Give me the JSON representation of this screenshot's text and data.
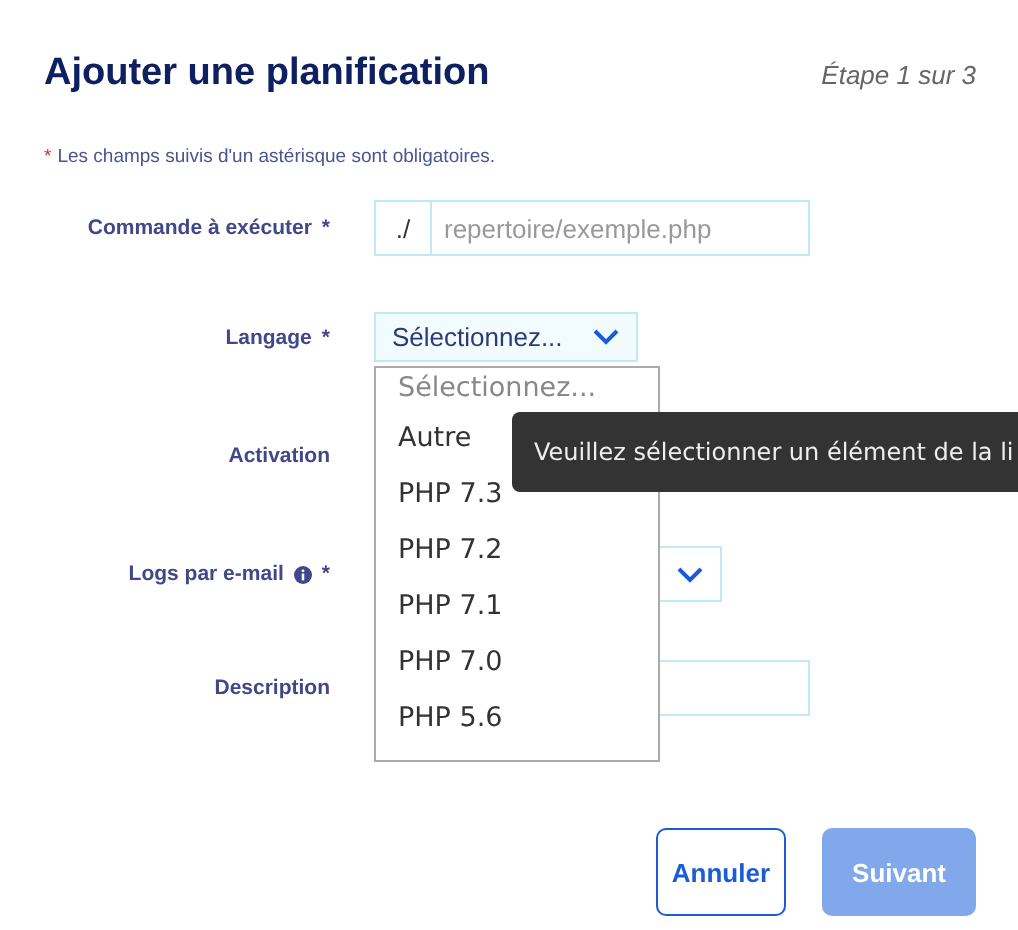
{
  "header": {
    "title": "Ajouter une planification",
    "step": "Étape 1 sur 3"
  },
  "required_note": {
    "mark": "*",
    "text": "Les champs suivis d'un astérisque sont obligatoires."
  },
  "fields": [
    {
      "kind": "prefixed",
      "label": "Commande à exécuter",
      "required_mark": "*",
      "prefix": "./",
      "placeholder": "repertoire/exemple.php"
    },
    {
      "kind": "select",
      "label": "Langage",
      "required_mark": "*",
      "value": "Sélectionnez...",
      "open": true,
      "options": [
        {
          "kind": "placeholder",
          "label": "Sélectionnez..."
        },
        {
          "kind": "option",
          "label": "Autre"
        },
        {
          "kind": "option",
          "label": "PHP 7.3"
        },
        {
          "kind": "option",
          "label": "PHP 7.2"
        },
        {
          "kind": "option",
          "label": "PHP 7.1"
        },
        {
          "kind": "option",
          "label": "PHP 7.0"
        },
        {
          "kind": "option",
          "label": "PHP 5.6"
        }
      ],
      "tooltip": "Veuillez sélectionner un élément de la li"
    },
    {
      "kind": "hidden",
      "label": "Activation"
    },
    {
      "kind": "select",
      "label": "Logs par e-mail",
      "info": true,
      "required_mark": "*",
      "open": false
    },
    {
      "kind": "text",
      "label": "Description"
    }
  ],
  "buttons": [
    {
      "kind": "secondary",
      "label": "Annuler",
      "disabled": false
    },
    {
      "kind": "primary",
      "label": "Suivant",
      "disabled": true
    }
  ]
}
